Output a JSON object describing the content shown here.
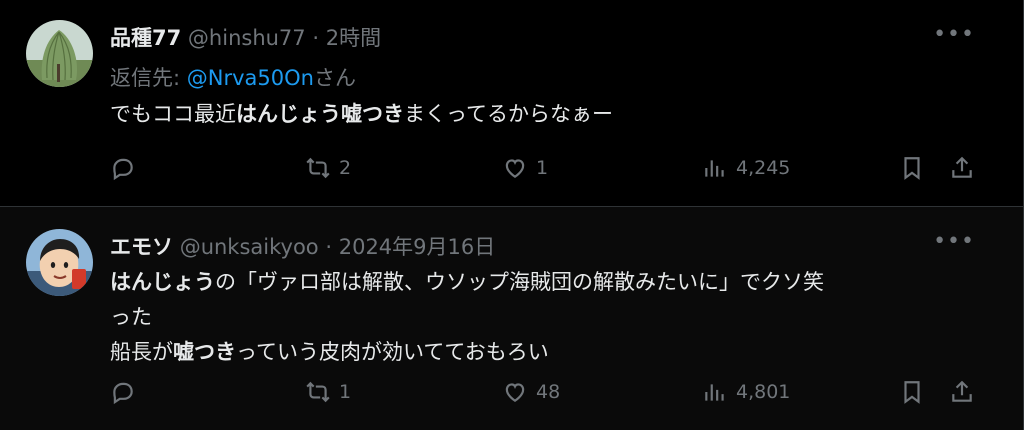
{
  "posts": [
    {
      "author": {
        "display_name": "品種77",
        "handle": "@hinshu77",
        "separator": "·",
        "time": "2時間"
      },
      "reply_to": {
        "prefix": "返信先: ",
        "mention": "@Nrva50On",
        "suffix": "さん"
      },
      "body": [
        [
          {
            "text": "でもココ最近",
            "bold": false
          },
          {
            "text": "はんじょう嘘つき",
            "bold": true
          },
          {
            "text": "まくってるからなぁー",
            "bold": false
          }
        ]
      ],
      "stats": {
        "reposts": "2",
        "likes": "1",
        "views": "4,245"
      },
      "more_label": "•••"
    },
    {
      "author": {
        "display_name": "エモソ",
        "handle": "@unksaikyoo",
        "separator": "·",
        "time": "2024年9月16日"
      },
      "body": [
        [
          {
            "text": "はんじょう",
            "bold": true
          },
          {
            "text": "の「ヴァロ部は解散、ウソップ海賊団の解散みたいに」でクソ笑",
            "bold": false
          }
        ],
        [
          {
            "text": "った",
            "bold": false
          }
        ],
        [
          {
            "text": "船長が",
            "bold": false
          },
          {
            "text": "嘘つき",
            "bold": true
          },
          {
            "text": "っていう皮肉が効いてておもろい",
            "bold": false
          }
        ]
      ],
      "stats": {
        "reposts": "1",
        "likes": "48",
        "views": "4,801"
      },
      "more_label": "•••"
    }
  ],
  "icons": {
    "reply": "reply-icon",
    "repost": "repost-icon",
    "like": "heart-icon",
    "views": "views-chart-icon",
    "bookmark": "bookmark-icon",
    "share": "share-icon"
  },
  "colors": {
    "background": "#000000",
    "text": "#e7e9ea",
    "muted": "#71767b",
    "link": "#1d9bf0",
    "border": "#2f3336"
  }
}
